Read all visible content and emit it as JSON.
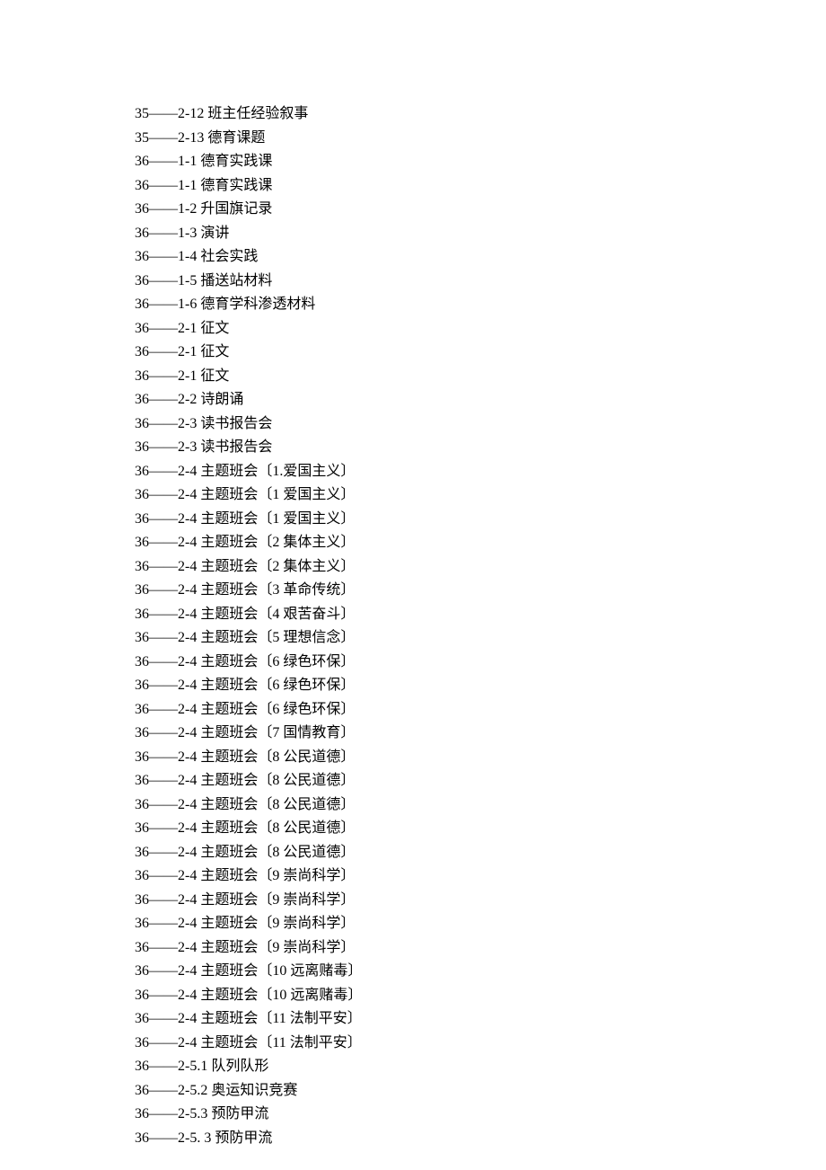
{
  "lines": [
    "35——2-12 班主任经验叙事",
    "35——2-13 德育课题",
    "36——1-1 德育实践课",
    "36——1-1 德育实践课",
    "36——1-2 升国旗记录",
    "36——1-3 演讲",
    "36——1-4 社会实践",
    "36——1-5 播送站材料",
    "36——1-6 德育学科渗透材料",
    "36——2-1 征文",
    "36——2-1 征文",
    "36——2-1 征文",
    "36——2-2 诗朗诵",
    "36——2-3 读书报告会",
    "36——2-3 读书报告会",
    "36——2-4 主题班会〔1.爱国主义〕",
    "36——2-4 主题班会〔1 爱国主义〕",
    "36——2-4 主题班会〔1 爱国主义〕",
    "36——2-4 主题班会〔2 集体主义〕",
    "36——2-4 主题班会〔2 集体主义〕",
    "36——2-4 主题班会〔3 革命传统〕",
    "36——2-4 主题班会〔4 艰苦奋斗〕",
    "36——2-4 主题班会〔5 理想信念〕",
    "36——2-4 主题班会〔6 绿色环保〕",
    "36——2-4 主题班会〔6 绿色环保〕",
    "36——2-4 主题班会〔6 绿色环保〕",
    "36——2-4 主题班会〔7 国情教育〕",
    "36——2-4 主题班会〔8 公民道德〕",
    "36——2-4 主题班会〔8 公民道德〕",
    "36——2-4 主题班会〔8 公民道德〕",
    "36——2-4 主题班会〔8 公民道德〕",
    "36——2-4 主题班会〔8 公民道德〕",
    "36——2-4 主题班会〔9 崇尚科学〕",
    "36——2-4 主题班会〔9 崇尚科学〕",
    "36——2-4 主题班会〔9 崇尚科学〕",
    "36——2-4 主题班会〔9 崇尚科学〕",
    "36——2-4 主题班会〔10 远离赌毒〕",
    "36——2-4 主题班会〔10 远离赌毒〕",
    "36——2-4 主题班会〔11 法制平安〕",
    "36——2-4 主题班会〔11 法制平安〕",
    "36——2-5.1 队列队形",
    "36——2-5.2 奥运知识竞赛",
    "36——2-5.3 预防甲流",
    "36——2-5. 3 预防甲流"
  ]
}
